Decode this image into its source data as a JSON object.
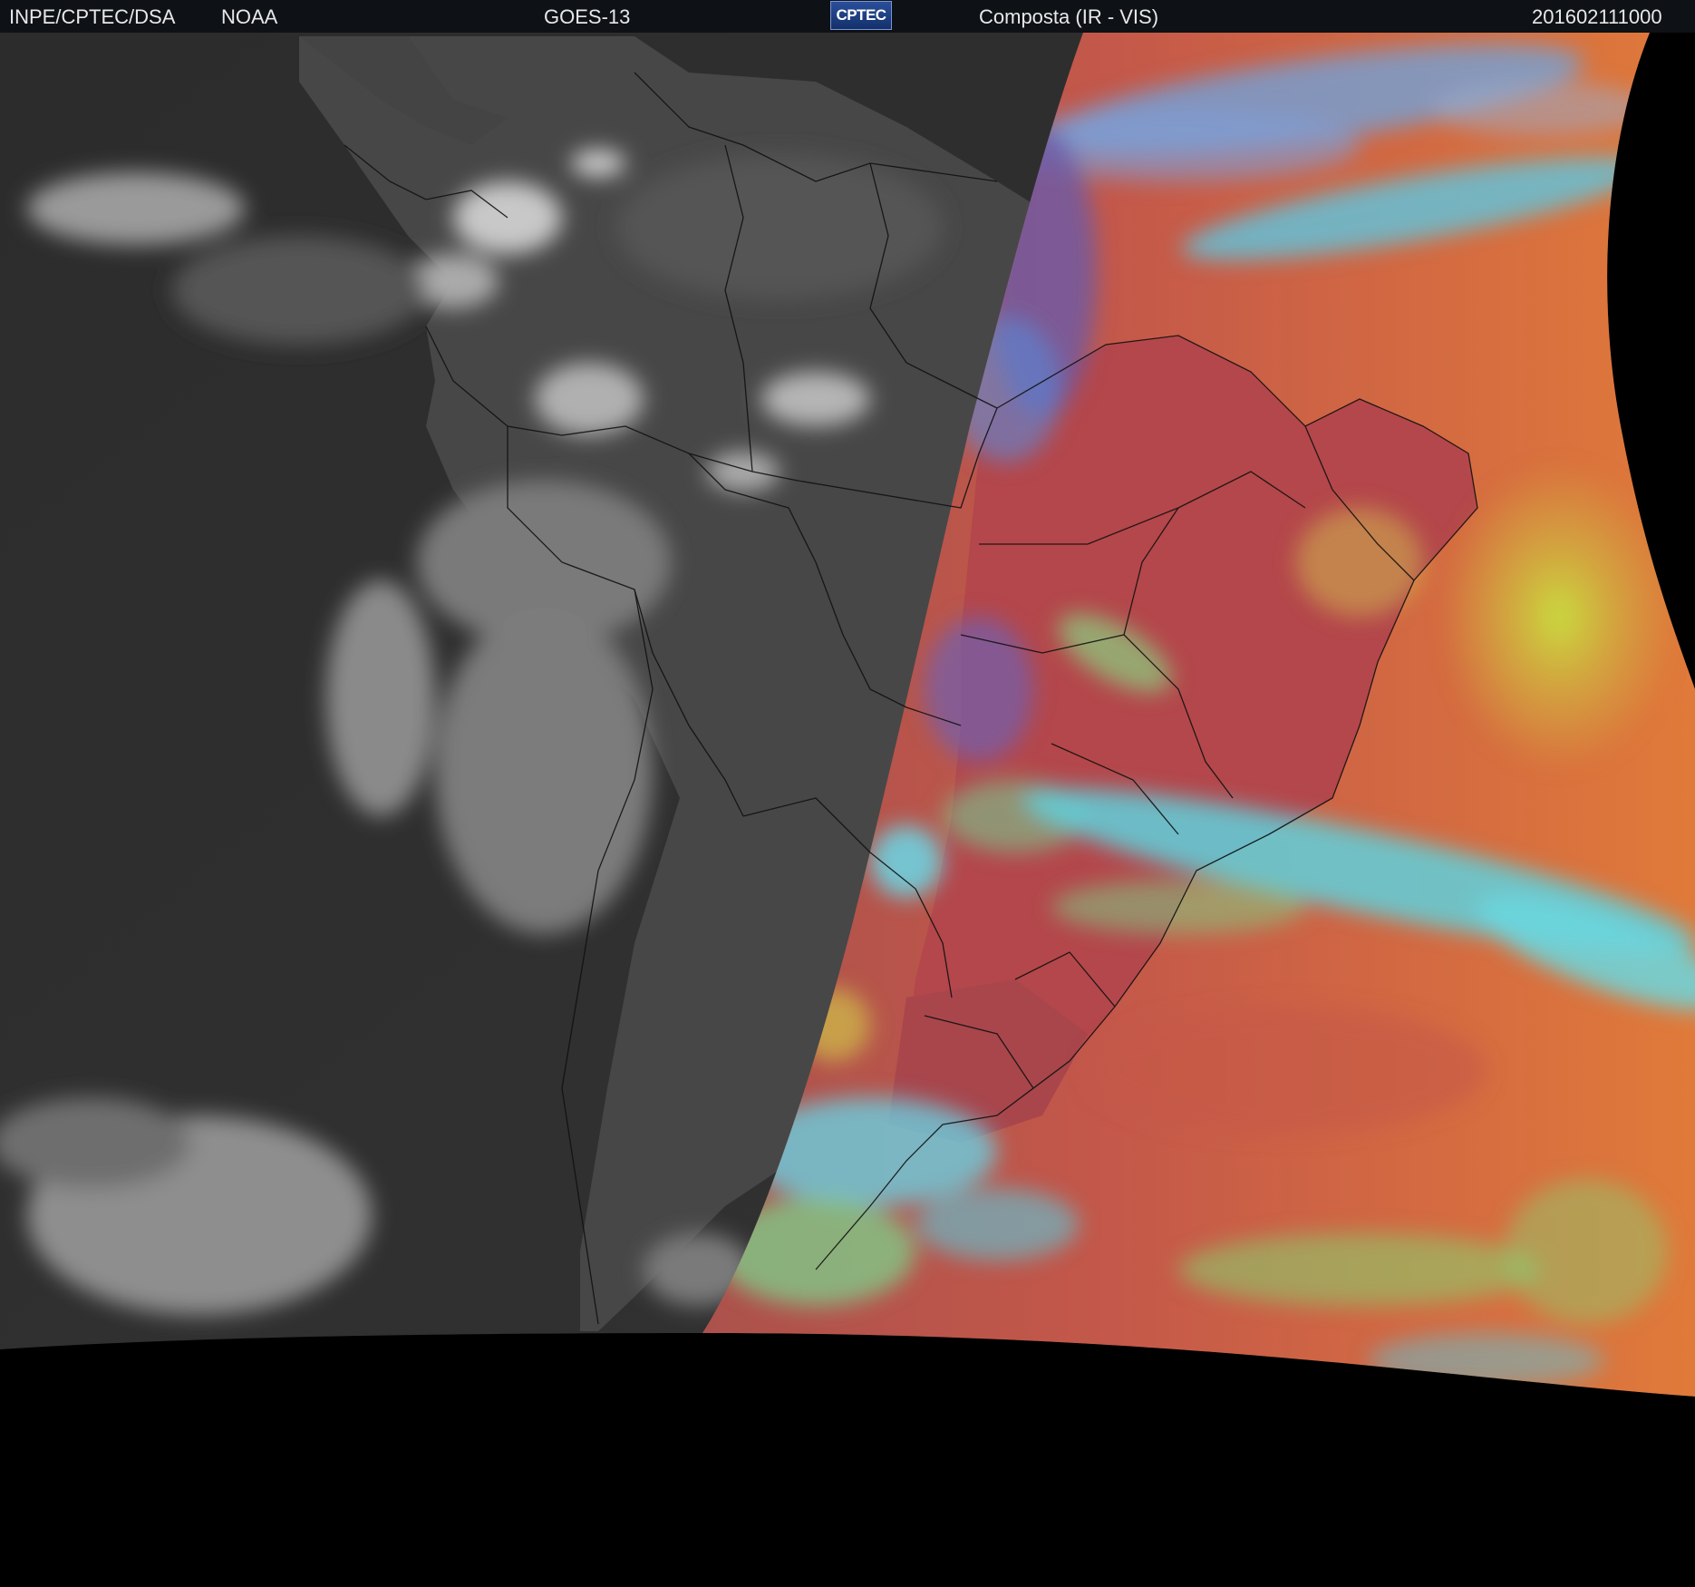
{
  "header": {
    "agency": "INPE/CPTEC/DSA",
    "partner": "NOAA",
    "satellite": "GOES-13",
    "logo_text": "CPTEC",
    "product": "Composta (IR - VIS)",
    "timestamp": "201602111000"
  },
  "colors": {
    "background": "#000000",
    "header_bg": "#0e1116",
    "header_text": "#e8e8e8",
    "ir_dark_ocean": "#2a2a2a",
    "ir_land": "#4a4a4a",
    "ir_cloud": "#b8b8b8",
    "vis_red_surface": "#b8504a",
    "vis_ocean_orange": "#d9703f",
    "vis_cyan_cloud": "#5ec8d8",
    "vis_green_cloud": "#7fd87a",
    "vis_yellow_sunglint": "#c8d84a",
    "vis_purple_edge": "#6a5aa8",
    "borders": "#101010"
  }
}
